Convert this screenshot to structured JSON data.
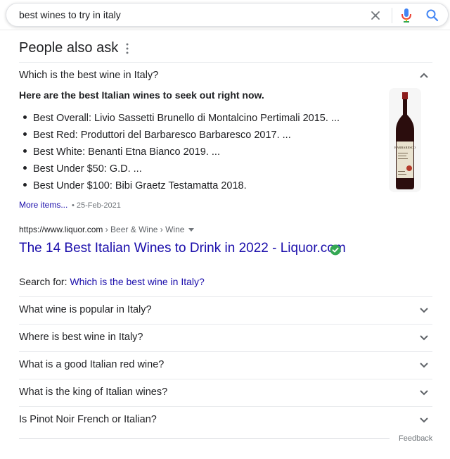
{
  "search": {
    "query": "best wines to try in italy"
  },
  "paa": {
    "title": "People also ask",
    "expanded": {
      "question": "Which is the best wine in Italy?",
      "answer_heading": "Here are the best Italian wines to seek out right now.",
      "items": [
        "Best Overall: Livio Sassetti Brunello di Montalcino Pertimali 2015. ...",
        "Best Red: Produttori del Barbaresco Barbaresco 2017. ...",
        "Best White: Benanti Etna Bianco 2019. ...",
        "Best Under $50: G.D. ...",
        "Best Under $100: Bibi Graetz Testamatta 2018."
      ],
      "more_items": "More items...",
      "date": "• 25-Feb-2021",
      "image_label": "BARBARESCO",
      "source_url": "https://www.liquor.com",
      "breadcrumb": " › Beer & Wine › Wine",
      "result_title": "The 14 Best Italian Wines to Drink in 2022 - Liquor.com",
      "search_for_label": "Search for: ",
      "search_for_link": "Which is the best wine in Italy?"
    },
    "questions": [
      "What wine is popular in Italy?",
      "Where is best wine in Italy?",
      "What is a good Italian red wine?",
      "What is the king of Italian wines?",
      "Is Pinot Noir French or Italian?"
    ],
    "feedback": "Feedback"
  },
  "colors": {
    "link": "#1a0dab",
    "text": "#202124",
    "muted": "#70757a",
    "verified": "#34a853"
  },
  "icons": [
    "close-icon",
    "mic-icon",
    "search-icon",
    "more-vert-icon",
    "chevron-up-icon",
    "chevron-down-icon",
    "verified-icon"
  ]
}
